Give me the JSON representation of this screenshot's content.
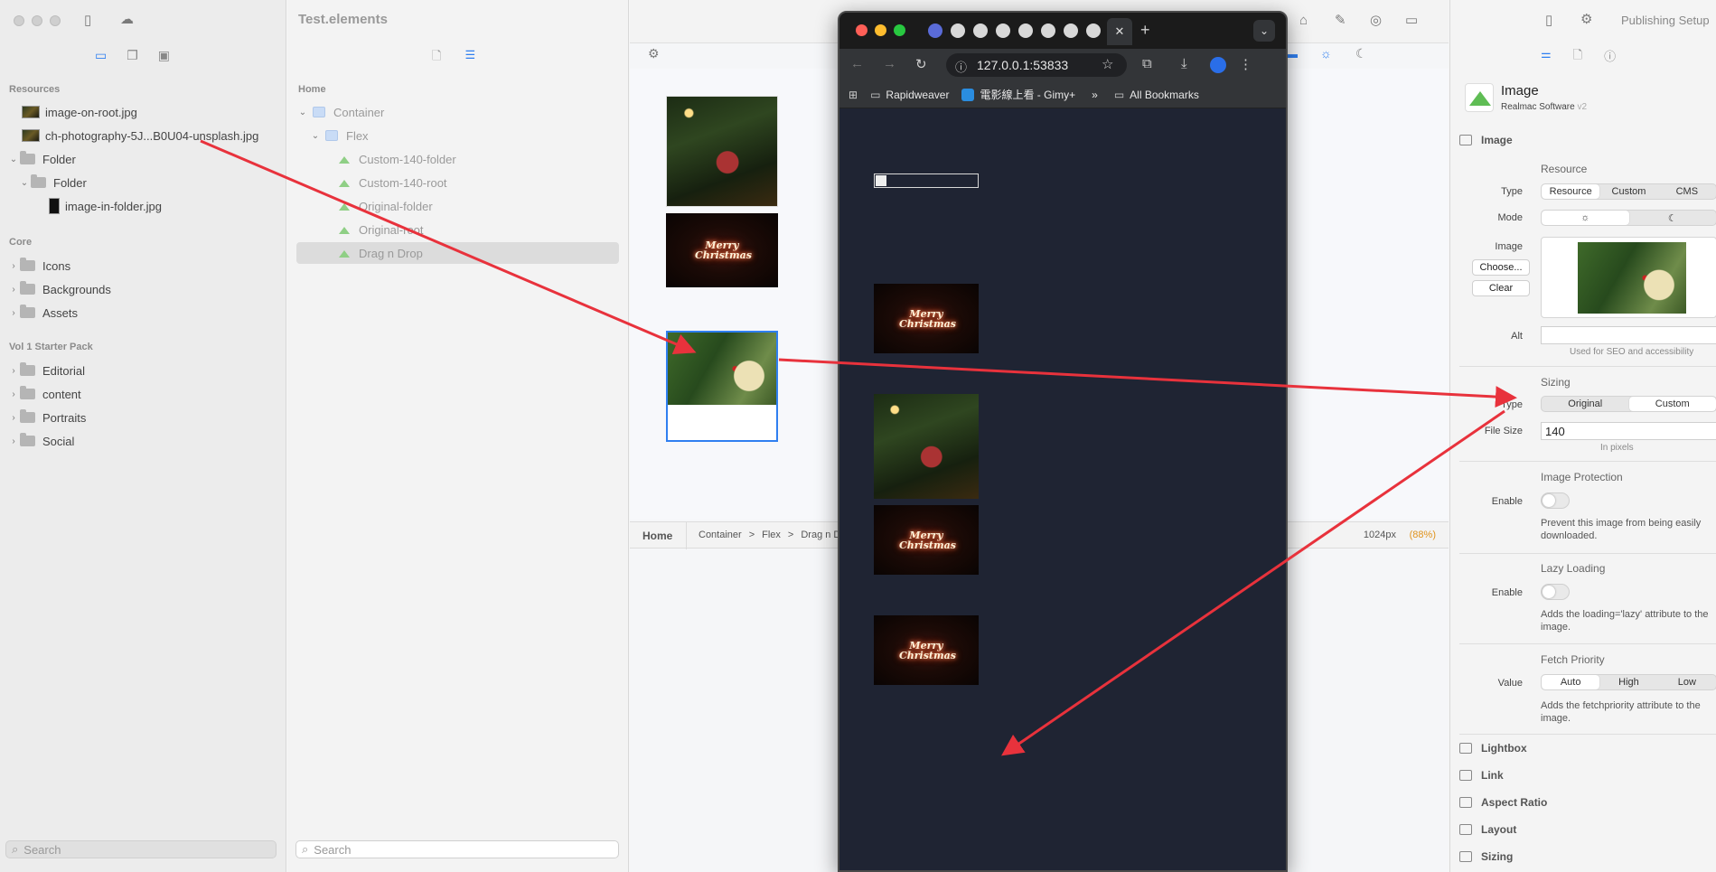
{
  "sidebar": {
    "resources_heading": "Resources",
    "resources": [
      {
        "label": "image-on-root.jpg"
      },
      {
        "label": "ch-photography-5J...B0U04-unsplash.jpg"
      }
    ],
    "folder_label": "Folder",
    "subfolder_label": "Folder",
    "folder_file": "image-in-folder.jpg",
    "core_heading": "Core",
    "core_items": [
      "Icons",
      "Backgrounds",
      "Assets"
    ],
    "pack_heading": "Vol 1 Starter Pack",
    "pack_items": [
      "Editorial",
      "content",
      "Portraits",
      "Social"
    ],
    "search_placeholder": "Search"
  },
  "structure": {
    "title": "Test.elements",
    "home_label": "Home",
    "nodes": {
      "container": "Container",
      "flex": "Flex",
      "custom_folder": "Custom-140-folder",
      "custom_root": "Custom-140-root",
      "original_folder": "Original-folder",
      "original_root": "Original-root",
      "drag_drop": "Drag n Drop"
    },
    "search_placeholder": "Search"
  },
  "canvas": {
    "photo_text": "Merry Christmas",
    "breadcrumb_home": "Home",
    "breadcrumb": [
      "Container",
      ">",
      "Flex",
      ">",
      "Drag n D"
    ],
    "width_readout": "1024px",
    "zoom_readout": "88%"
  },
  "toolbar_right": {
    "publishing_setup": "Publishing Setup"
  },
  "browser": {
    "url": "127.0.0.1:53833",
    "bookmarks": [
      "Rapidweaver",
      "電影線上看 - Gimy+",
      "All Bookmarks"
    ],
    "more_label": "»",
    "new_tab_label": "+"
  },
  "inspector": {
    "title": "Image",
    "vendor": "Realmac Software",
    "version": "v2",
    "section_image": "Image",
    "resource_heading": "Resource",
    "type_label": "Type",
    "type_options": [
      "Resource",
      "Custom",
      "CMS"
    ],
    "type_selected": "Resource",
    "mode_label": "Mode",
    "mode_light": "☼",
    "mode_dark": "☾",
    "image_label": "Image",
    "choose_button": "Choose...",
    "clear_button": "Clear",
    "alt_label": "Alt",
    "alt_value": "",
    "alt_hint": "Used for SEO and accessibility",
    "sizing_heading": "Sizing",
    "sizing_type_label": "Type",
    "sizing_options": [
      "Original",
      "Custom"
    ],
    "sizing_selected": "Custom",
    "file_size_label": "File Size",
    "file_size_value": "140",
    "file_size_hint": "In pixels",
    "protection_heading": "Image Protection",
    "enable_label": "Enable",
    "protection_desc": "Prevent this image from being easily downloaded.",
    "lazy_heading": "Lazy Loading",
    "lazy_enable_label": "Enable",
    "lazy_desc": "Adds the loading='lazy' attribute to the image.",
    "fetch_heading": "Fetch Priority",
    "fetch_label": "Value",
    "fetch_options": [
      "Auto",
      "High",
      "Low"
    ],
    "fetch_selected": "Auto",
    "fetch_desc": "Adds the fetchpriority attribute to the image.",
    "collapsed_sections": [
      "Lightbox",
      "Link",
      "Aspect Ratio",
      "Layout",
      "Sizing"
    ]
  },
  "colors": {
    "accent": "#2f7ff0",
    "arrow": "#e8323c",
    "zoom": "#e0931c"
  }
}
